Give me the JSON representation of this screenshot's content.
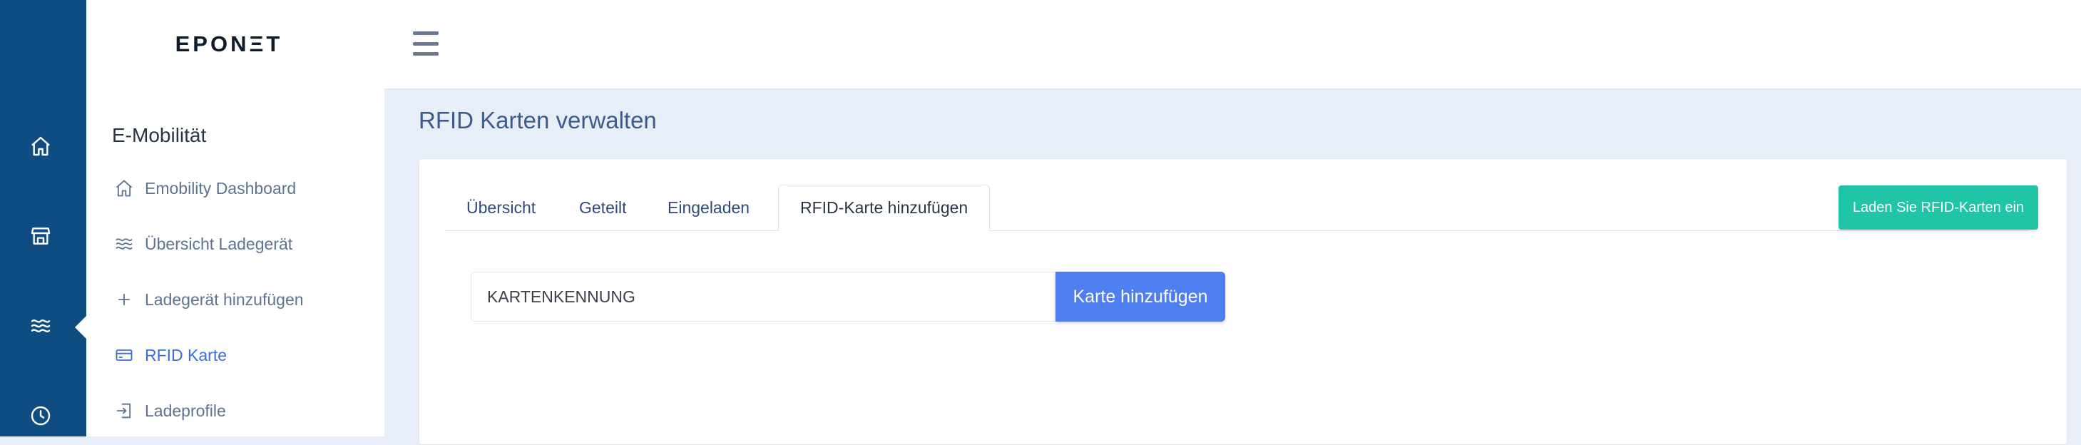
{
  "brand": {
    "logo_text": "EPONΞT"
  },
  "rail": {
    "icons": [
      "home-icon",
      "store-icon",
      "waves-icon",
      "clock-icon"
    ],
    "color": "#0f4c81"
  },
  "sidebar": {
    "title": "E-Mobilität",
    "items": [
      {
        "label": "Emobility Dashboard",
        "icon": "home-icon"
      },
      {
        "label": "Übersicht Ladegerät",
        "icon": "waves-icon"
      },
      {
        "label": "Ladegerät hinzufügen",
        "icon": "plus-icon"
      },
      {
        "label": "RFID Karte",
        "icon": "card-icon",
        "active": true
      },
      {
        "label": "Ladeprofile",
        "icon": "login-icon"
      }
    ]
  },
  "main": {
    "title": "RFID Karten verwalten",
    "tabs": [
      {
        "label": "Übersicht"
      },
      {
        "label": "Geteilt"
      },
      {
        "label": "Eingeladen"
      },
      {
        "label": "RFID-Karte hinzufügen",
        "active": true
      }
    ],
    "load_button": "Laden Sie RFID-Karten ein",
    "card_input": {
      "value": "",
      "placeholder": "KARTENKENNUNG"
    },
    "add_button": "Karte hinzufügen"
  },
  "colors": {
    "accent": "#4f7ef0",
    "teal": "#20c4a7",
    "active_link": "#3b6fe0",
    "background": "#e8eef7"
  }
}
